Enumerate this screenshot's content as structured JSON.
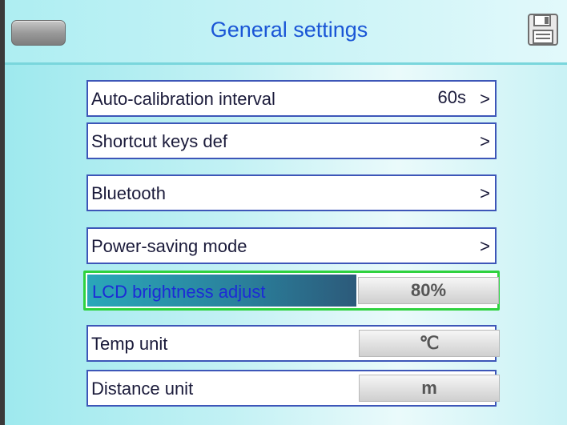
{
  "header": {
    "title": "General settings",
    "back_icon": "back-button-icon",
    "save_icon": "floppy-disk-icon"
  },
  "settings": [
    {
      "label": "Auto-calibration interval",
      "value": "60s",
      "chevron": ">"
    },
    {
      "label": "Shortcut keys def",
      "value": "",
      "chevron": ">"
    },
    {
      "label": "Bluetooth",
      "value": "",
      "chevron": ">"
    },
    {
      "label": "Power-saving mode",
      "value": "",
      "chevron": ">"
    },
    {
      "label": "LCD brightness adjust",
      "value": "80%"
    },
    {
      "label": "Temp unit",
      "value": "℃"
    },
    {
      "label": "Distance unit",
      "value": "m"
    }
  ],
  "colors": {
    "title": "#1a56d6",
    "selection_border": "#2fd23f",
    "row_border": "#3d56b8"
  }
}
